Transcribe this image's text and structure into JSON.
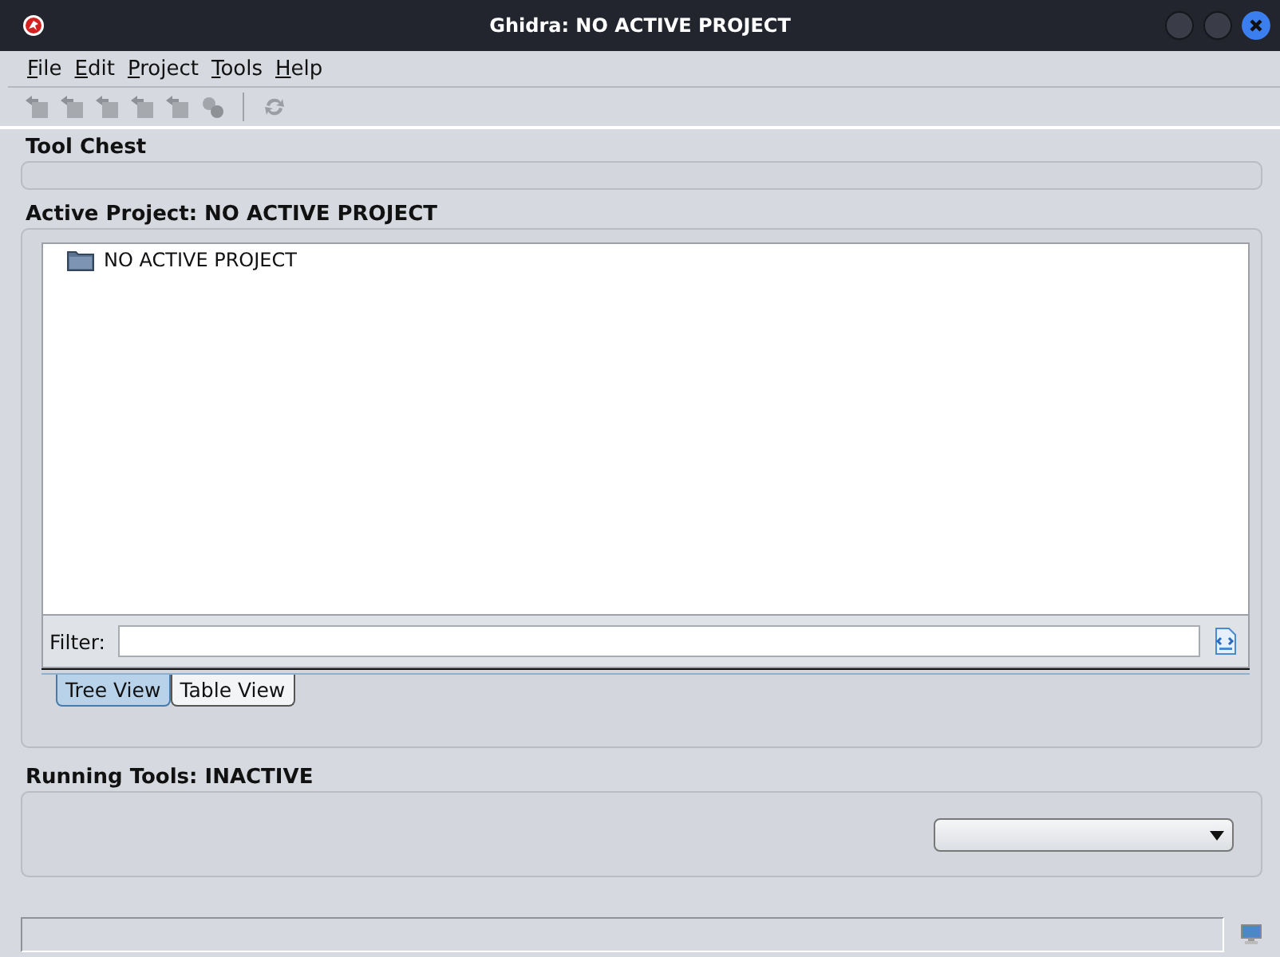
{
  "window": {
    "title": "Ghidra: NO ACTIVE PROJECT"
  },
  "menu": [
    "File",
    "Edit",
    "Project",
    "Tools",
    "Help"
  ],
  "toolbar": [
    {
      "disabled": true
    },
    {
      "disabled": true
    },
    {
      "disabled": true
    },
    {
      "disabled": true
    },
    {
      "disabled": true
    },
    {
      "disabled": true
    },
    {
      "disabled": true
    }
  ],
  "tool_chest": {
    "title": "Tool Chest"
  },
  "active_project": {
    "title": "Active Project: NO ACTIVE PROJECT",
    "tree": [
      {
        "label": "NO ACTIVE PROJECT"
      }
    ],
    "filter_label": "Filter:",
    "tabs": [
      {
        "label": "Tree View",
        "selected": true
      },
      {
        "label": "Table View",
        "selected": false
      }
    ]
  },
  "running_tools": {
    "title": "Running Tools: INACTIVE"
  }
}
